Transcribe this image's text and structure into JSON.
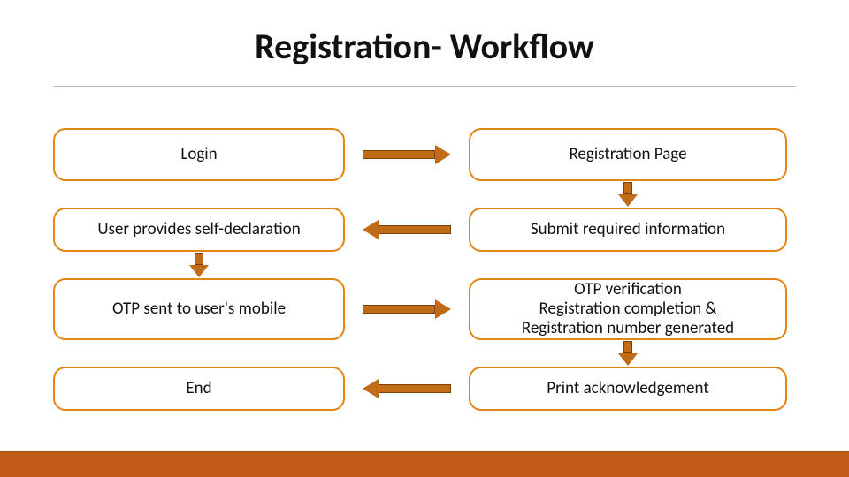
{
  "title": "Registration- Workflow",
  "nodes": {
    "n1": "Login",
    "n2": "Registration Page",
    "n3": "User provides self-declaration",
    "n4": "Submit required information",
    "n5": "OTP sent to user's mobile",
    "n6": "OTP verification\nRegistration completion  &\nRegistration number generated",
    "n7": "End",
    "n8": "Print acknowledgement"
  },
  "colors": {
    "node_border": "#e08516",
    "arrow_fill": "#bf6b17",
    "footer": "#c25a17"
  }
}
